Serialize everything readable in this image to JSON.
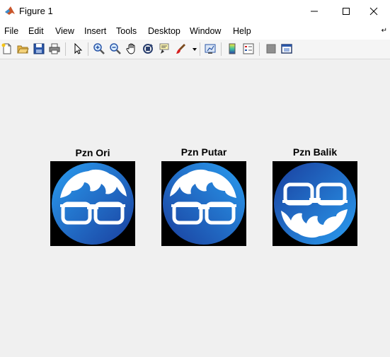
{
  "window": {
    "title": "Figure 1",
    "app_icon": "matlab-logo-icon",
    "controls": [
      "minimize-icon",
      "maximize-icon",
      "close-icon"
    ]
  },
  "menu": {
    "items": [
      "File",
      "Edit",
      "View",
      "Insert",
      "Tools",
      "Desktop",
      "Window",
      "Help"
    ],
    "dock_icon": "dock-arrow-icon"
  },
  "toolbar": {
    "buttons": [
      "new-figure-icon",
      "open-file-icon",
      "save-icon",
      "print-icon",
      "edit-plot-arrow-icon",
      "zoom-in-icon",
      "zoom-out-icon",
      "pan-hand-icon",
      "rotate-3d-icon",
      "data-cursor-icon",
      "brush-icon",
      "link-plot-icon",
      "insert-colorbar-icon",
      "insert-legend-icon",
      "hide-plot-tools-icon",
      "show-plot-tools-icon"
    ]
  },
  "subplots": [
    {
      "title": "Pzn Ori",
      "variant": "original"
    },
    {
      "title": "Pzn Putar",
      "variant": "rotated"
    },
    {
      "title": "Pzn Balik",
      "variant": "flipped"
    }
  ],
  "colors": {
    "logo_blue_light": "#1e8ee0",
    "logo_blue_dark": "#1a4fb0",
    "background": "#f0f0f0"
  }
}
